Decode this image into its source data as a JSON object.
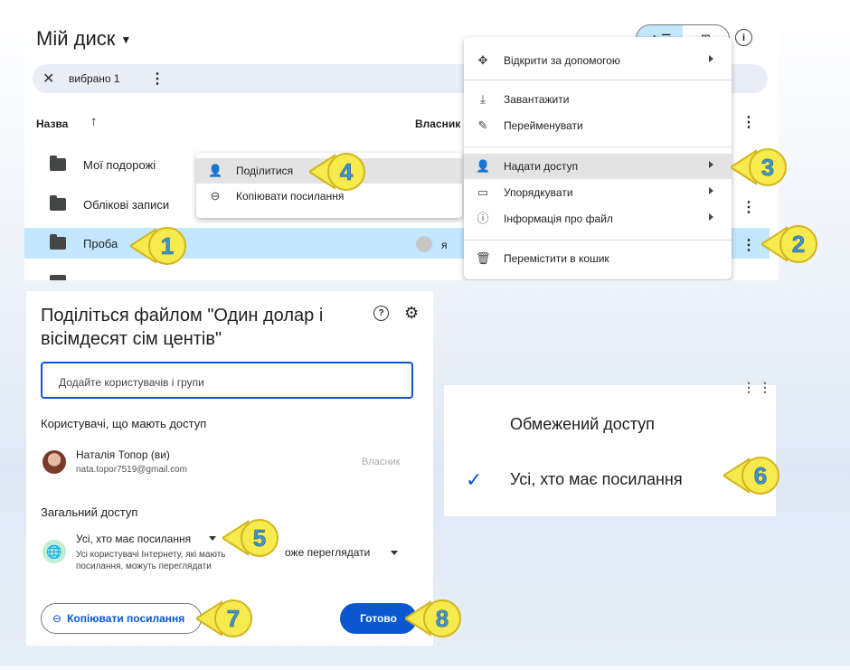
{
  "drive": {
    "title": "Мій диск",
    "view_toggle": {
      "list_icon": "✓ ☰",
      "grid_icon": "⊞"
    },
    "selection": {
      "count_label": "вибрано 1"
    },
    "columns": {
      "name": "Назва",
      "owner": "Власник"
    },
    "rows": [
      {
        "name": "Мої подорожі",
        "icon": "shared-folder-icon"
      },
      {
        "name": "Облікові записи",
        "icon": "folder-icon"
      },
      {
        "name": "Проба",
        "icon": "folder-icon",
        "owner": "я",
        "selected": true
      }
    ],
    "context_menu": [
      {
        "label": "Відкрити за допомогою",
        "icon": "move-icon",
        "submenu": true
      },
      {
        "label": "Завантажити",
        "icon": "download-icon"
      },
      {
        "label": "Перейменувати",
        "icon": "rename-icon"
      },
      {
        "label": "Надати доступ",
        "icon": "add-person-icon",
        "submenu": true,
        "highlighted": true
      },
      {
        "label": "Упорядкувати",
        "icon": "folder-open-icon",
        "submenu": true
      },
      {
        "label": "Інформація про файл",
        "icon": "info-icon",
        "submenu": true
      },
      {
        "label": "Перемістити в кошик",
        "icon": "trash-icon"
      }
    ],
    "share_submenu": [
      {
        "label": "Поділитися",
        "icon": "add-person-icon",
        "highlighted": true
      },
      {
        "label": "Копіювати посилання",
        "icon": "link-icon"
      }
    ]
  },
  "share_dialog": {
    "title": "Поділіться файлом \"Один долар і вісімдесят сім центів\"",
    "add_placeholder": "Додайте користувачів і групи",
    "people_heading": "Користувачі, що мають доступ",
    "user": {
      "name": "Наталія Топор (ви)",
      "email": "nata.topor7519@gmail.com",
      "role": "Власник"
    },
    "general_heading": "Загальний доступ",
    "access_label": "Усі, хто має посилання",
    "access_desc": "Усі користувачі Інтернету, які мають посилання, можуть переглядати",
    "role_label": "оже переглядати",
    "copy_link": "Копіювати посилання",
    "done": "Готово"
  },
  "access_dropdown": {
    "options": [
      "Обмежений доступ",
      "Усі, хто має посилання"
    ],
    "selected": "Усі, хто має посилання"
  },
  "callouts": [
    "1",
    "2",
    "3",
    "4",
    "5",
    "6",
    "7",
    "8"
  ],
  "colors": {
    "accent": "#0b57d0",
    "selection": "#c2e7ff",
    "callout_fill": "#f6ea4d",
    "callout_text": "#3f95cc"
  }
}
